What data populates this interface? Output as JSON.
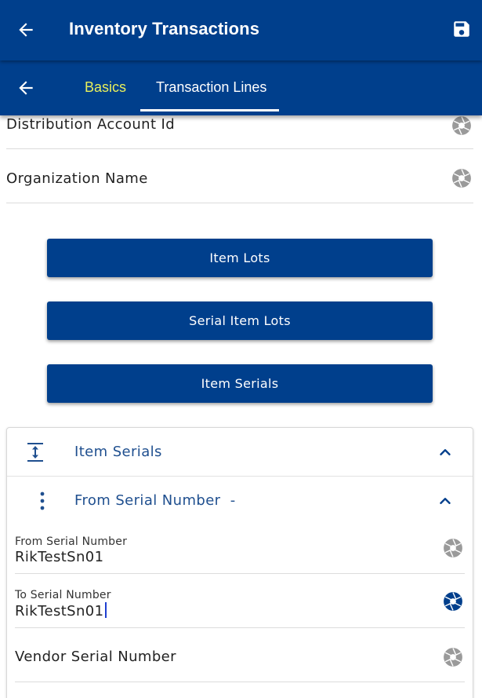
{
  "header": {
    "title": "Inventory Transactions",
    "back_icon": "arrow-left-icon",
    "save_icon": "save-icon"
  },
  "tabs": {
    "back_icon": "arrow-left-icon",
    "items": [
      {
        "label": "Basics",
        "active": false,
        "color": "#e8ef5b"
      },
      {
        "label": "Transaction Lines",
        "active": true,
        "color": "#ffffff"
      }
    ]
  },
  "fields_top": [
    {
      "label": "Distribution Account Id",
      "icon": "aperture-icon"
    },
    {
      "label": "Organization Name",
      "icon": "aperture-icon"
    }
  ],
  "buttons": [
    {
      "label": "Item Lots"
    },
    {
      "label": "Serial Item Lots"
    },
    {
      "label": "Item Serials"
    }
  ],
  "section": {
    "title": "Item Serials",
    "icon": "expand-vertical-icon",
    "toggle_icon": "chevron-up-icon",
    "sub": {
      "title": "From Serial Number  -",
      "icon": "more-vertical-icon",
      "toggle_icon": "chevron-up-icon"
    },
    "fields": [
      {
        "label": "From Serial Number",
        "value": "RikTestSn01",
        "icon": "aperture-icon"
      },
      {
        "label": "To Serial Number",
        "value": "RikTestSn01",
        "icon": "aperture-icon",
        "focused": true
      },
      {
        "label": "Vendor Serial Number",
        "value": "",
        "icon": "aperture-icon"
      }
    ]
  },
  "colors": {
    "primary": "#003f8c",
    "accent_tab": "#e8ef5b",
    "section_text": "#1f4f8f",
    "icon_gray": "#9a9a9a",
    "icon_active": "#003f8c"
  }
}
